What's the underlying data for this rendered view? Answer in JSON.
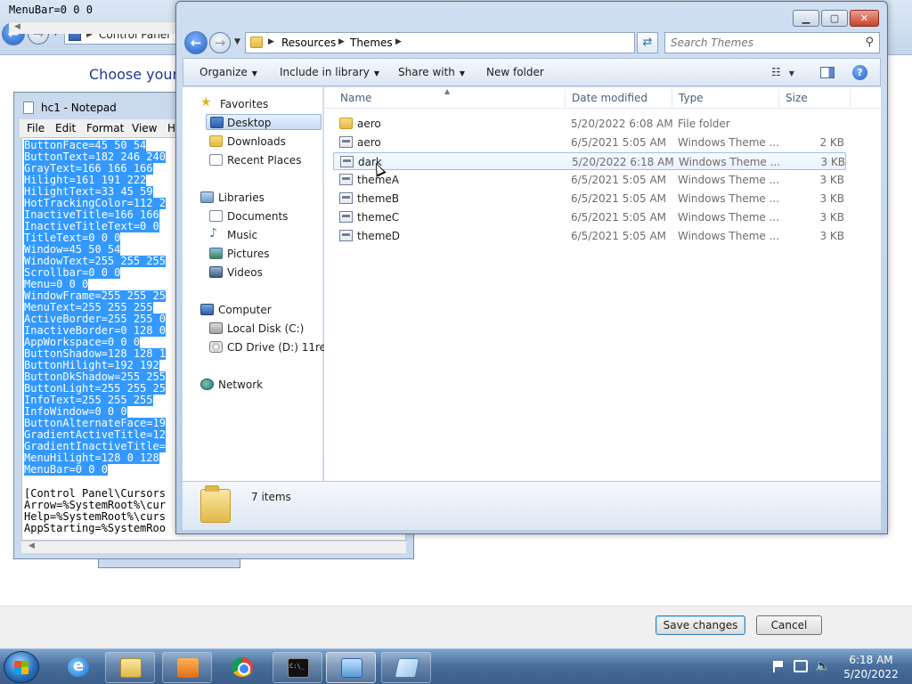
{
  "control_panel": {
    "address": "Control Panel",
    "heading": "Choose your c",
    "save_label": "Save changes",
    "cancel_label": "Cancel"
  },
  "notepad": {
    "title": "hc1 - Notepad",
    "menu": [
      "File",
      "Edit",
      "Format",
      "View",
      "H"
    ],
    "selected_lines": [
      "ButtonFace=45 50 54",
      "ButtonText=182 246 240",
      "GrayText=166 166 166",
      "Hilight=161 191 222",
      "HilightText=33 45 59",
      "HotTrackingColor=112 2",
      "InactiveTitle=166 166",
      "InactiveTitleText=0 0",
      "TitleText=0 0 0",
      "Window=45 50 54",
      "WindowText=255 255 255",
      "Scrollbar=0 0 0",
      "Menu=0 0 0",
      "WindowFrame=255 255 25",
      "MenuText=255 255 255",
      "ActiveBorder=255 255 0",
      "InactiveBorder=0 128 0",
      "AppWorkspace=0 0 0",
      "ButtonShadow=128 128 1",
      "ButtonHilight=192 192",
      "ButtonDkShadow=255 255",
      "ButtonLight=255 255 25",
      "InfoText=255 255 255",
      "InfoWindow=0 0 0",
      "ButtonAlternateFace=19",
      "GradientActiveTitle=12",
      "GradientInactiveTitle=",
      "MenuHilight=128 0 128",
      "MenuBar=0 0 0"
    ],
    "plain_lines": [
      "[Control Panel\\Cursors",
      "Arrow=%SystemRoot%\\cur",
      "Help=%SystemRoot%\\curs",
      "AppStarting=%SystemRoo"
    ]
  },
  "notepad2": {
    "line": "MenuBar=0 0 0"
  },
  "explorer": {
    "breadcrumb": [
      "Resources",
      "Themes"
    ],
    "search_placeholder": "Search Themes",
    "toolbar": {
      "organize": "Organize",
      "include": "Include in library",
      "share": "Share with",
      "new_folder": "New folder"
    },
    "nav": {
      "favorites": "Favorites",
      "desktop": "Desktop",
      "downloads": "Downloads",
      "recent": "Recent Places",
      "libraries": "Libraries",
      "documents": "Documents",
      "music": "Music",
      "pictures": "Pictures",
      "videos": "Videos",
      "computer": "Computer",
      "local_disk": "Local Disk (C:)",
      "cd_drive": "CD Drive (D:) 11res",
      "network": "Network"
    },
    "columns": {
      "name": "Name",
      "date": "Date modified",
      "type": "Type",
      "size": "Size"
    },
    "files": [
      {
        "name": "aero",
        "date": "5/20/2022 6:08 AM",
        "type": "File folder",
        "size": "",
        "icon": "folder-icon"
      },
      {
        "name": "aero",
        "date": "6/5/2021 5:05 AM",
        "type": "Windows Theme ...",
        "size": "2 KB",
        "icon": "theme-file-icon"
      },
      {
        "name": "dark",
        "date": "5/20/2022 6:18 AM",
        "type": "Windows Theme ...",
        "size": "3 KB",
        "icon": "theme-file-icon"
      },
      {
        "name": "themeA",
        "date": "6/5/2021 5:05 AM",
        "type": "Windows Theme ...",
        "size": "3 KB",
        "icon": "theme-file-icon"
      },
      {
        "name": "themeB",
        "date": "6/5/2021 5:05 AM",
        "type": "Windows Theme ...",
        "size": "3 KB",
        "icon": "theme-file-icon"
      },
      {
        "name": "themeC",
        "date": "6/5/2021 5:05 AM",
        "type": "Windows Theme ...",
        "size": "3 KB",
        "icon": "theme-file-icon"
      },
      {
        "name": "themeD",
        "date": "6/5/2021 5:05 AM",
        "type": "Windows Theme ...",
        "size": "3 KB",
        "icon": "theme-file-icon"
      }
    ],
    "item_count": "7 items"
  },
  "taskbar": {
    "time": "6:18 AM",
    "date": "5/20/2022",
    "apps": [
      "internet-explorer-icon",
      "windows-explorer-icon",
      "media-player-icon",
      "chrome-icon",
      "command-prompt-icon",
      "control-panel-icon",
      "notepad-icon"
    ]
  }
}
